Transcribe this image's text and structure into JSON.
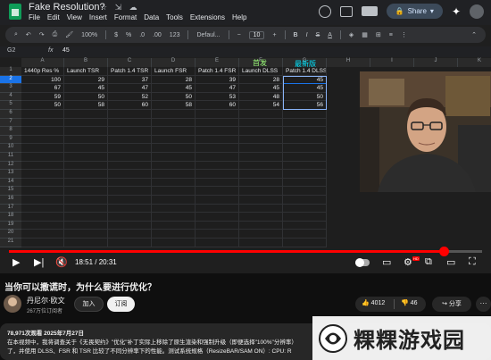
{
  "sheets": {
    "doc_title": "Fake Resolution?",
    "menu": [
      "File",
      "Edit",
      "View",
      "Insert",
      "Format",
      "Data",
      "Tools",
      "Extensions",
      "Help"
    ],
    "share_label": "Share",
    "toolbar": {
      "zoom": "100%",
      "currency": "$",
      "percent": "%",
      "dec_less": ".0",
      "dec_more": ".00",
      "number_format": "123",
      "font": "Defaul...",
      "font_size": "10",
      "bold": "B",
      "italic": "I",
      "text_color": "A"
    },
    "cell_ref": "G2",
    "formula_value": "45",
    "column_letters": [
      "A",
      "B",
      "C",
      "D",
      "E",
      "F",
      "G",
      "H",
      "I",
      "J",
      "K"
    ],
    "overlay_labels": {
      "first": "首发",
      "latest": "最新版"
    },
    "headers": [
      "1440p Res %",
      "Launch TSR",
      "Patch 1.4 TSR",
      "Launch FSR",
      "Patch 1.4 FSR",
      "Launch DLSS",
      "Patch 1.4 DLSS"
    ],
    "rows": [
      [
        "100",
        "29",
        "37",
        "28",
        "39",
        "28",
        "45"
      ],
      [
        "67",
        "45",
        "47",
        "45",
        "47",
        "45",
        "45"
      ],
      [
        "59",
        "50",
        "52",
        "50",
        "53",
        "48",
        "50"
      ],
      [
        "50",
        "58",
        "60",
        "58",
        "60",
        "54",
        "56"
      ]
    ],
    "row_numbers": [
      "1",
      "2",
      "3",
      "4",
      "5",
      "6",
      "7",
      "8",
      "9",
      "10",
      "11",
      "12",
      "13",
      "14",
      "15",
      "16",
      "17",
      "18",
      "19",
      "20",
      "21"
    ]
  },
  "player": {
    "time_current": "18:51",
    "time_total": "20:31",
    "progress_fraction": 0.919,
    "hd_badge": "HD"
  },
  "video": {
    "title": "当你可以撒谎时，为什么要进行优化？",
    "channel_name": "丹尼尔·欧文",
    "subscribers": "267万位订阅者",
    "join_label": "加入",
    "subscribe_label": "订阅",
    "likes": "4012",
    "comments_icon_count": "46",
    "share_label": "分享",
    "more_label": "···"
  },
  "description": {
    "meta": "78,971次观看  2025年7月27日",
    "line1": "在本视频中，我将调查关于《无畏契约》\"优化\"补丁实际上移除了原生渲染和强制升级（即便选择\"100%\"分辨率）",
    "line2": "了，并使用 DLSS、FSR 和 TSR 比较了不同分辨率下的性能。测试系统规格（ResizeBAR/SAM ON）: CPU: R"
  },
  "watermark": {
    "text": "粿粿游戏园"
  },
  "colors": {
    "accent": "#ff0000",
    "selection": "#1a73e8",
    "label_cyan": "#00e5ff",
    "label_green": "#9dff7a"
  }
}
